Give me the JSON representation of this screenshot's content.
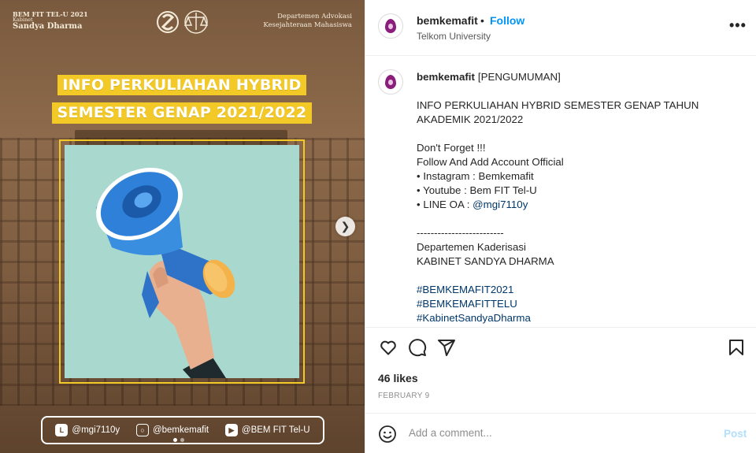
{
  "media": {
    "brand_line1": "BEM FIT TEL-U 2021",
    "brand_line2": "Kabinet",
    "brand_line3": "Sandya Dharma",
    "dept_line1": "Departemen Advokasi",
    "dept_line2": "Kesejahteraan Mahasiswa",
    "title_line1": "INFO PERKULIAHAN HYBRID",
    "title_line2": "SEMESTER GENAP  2021/2022",
    "social_line": "@mgi7110y",
    "social_instagram": "@bemkemafit",
    "social_youtube": "@BEM FIT Tel-U",
    "slide_count": 2,
    "active_slide": 1,
    "icons": {
      "line": "line-icon",
      "instagram": "instagram-icon",
      "youtube": "youtube-icon",
      "next": "chevron-right-icon"
    }
  },
  "header": {
    "username": "bemkemafit",
    "separator": "•",
    "follow_label": "Follow",
    "location": "Telkom University",
    "more_label": "•••"
  },
  "caption": {
    "username": "bemkemafit",
    "first_line": "[PENGUMUMAN]",
    "lines": [
      "INFO PERKULIAHAN HYBRID SEMESTER GENAP TAHUN",
      "AKADEMIK 2021/2022",
      "",
      "Don't Forget !!!",
      "Follow And Add Account Official",
      "• Instagram : Bemkemafit",
      "• Youtube : Bem FIT Tel-U",
      "• LINE OA : ",
      "",
      "-------------------------",
      "Departemen Kaderisasi",
      "KABINET SANDYA DHARMA",
      ""
    ],
    "line_oa_mention": "@mgi7110y",
    "hashtags": [
      "#BEMKEMAFIT2021",
      "#BEMKEMAFITTELU",
      "#KabinetSandyaDharma"
    ]
  },
  "engagement": {
    "likes": "46 likes",
    "date": "FEBRUARY 9"
  },
  "comment": {
    "placeholder": "Add a comment...",
    "post_label": "Post"
  },
  "colors": {
    "link_blue": "#0095f6",
    "hashtag_blue": "#00376b",
    "title_band_yellow": "#f3c928",
    "post_disabled": "#b2dffc"
  }
}
